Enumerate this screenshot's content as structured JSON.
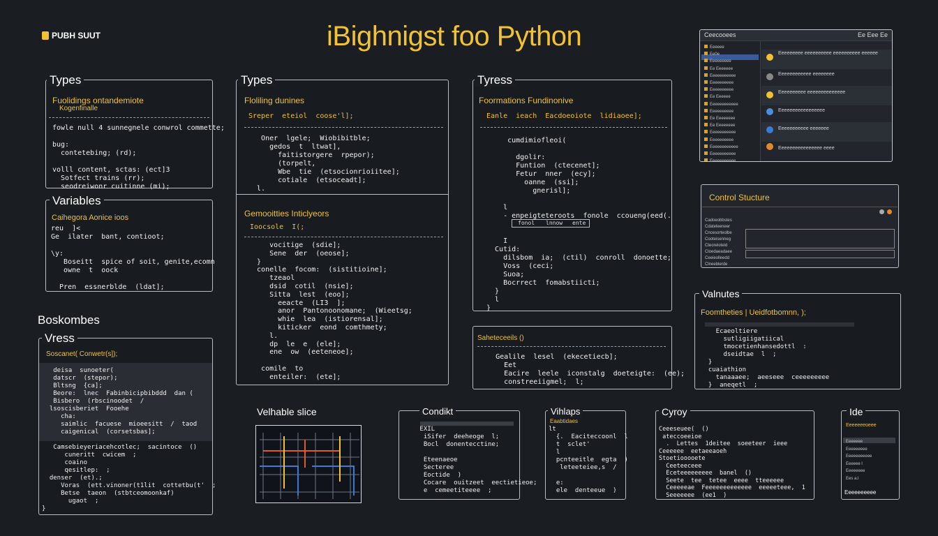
{
  "brand": "PUBH SUUT",
  "title": "iBighnigst foo Python",
  "panels": {
    "types1": {
      "header": "Types",
      "sub1": "Fuolidings ontandemiote",
      "sub2": "Kogenfinalle",
      "code": "fowle null 4 sunnegnele conwrol commette;\n\nbug:\n  contetebing; (rd);\n\nvolll content, sctas: (ect]3\n  Sotfect trains (rr);\n  seodreiwonr cuitinne (mi);"
    },
    "variables": {
      "header": "Variables",
      "sub1": "Caihegora Aonice ioos",
      "code": "reu  ]<\nGe  ilater  bant, contioot;\n\n\\y:\n   Boseitt  spice of soit, genite,ecomn\n   owne  t  oock\n\n  Pren  essnerblde  (ldat];"
    },
    "boskombes": {
      "header": "Boskombes",
      "sub_header": "Vress",
      "sub1": "Soscanet( Conwetr(s]);",
      "code": "   deisa  sunoeter(\n   datscr  (stepor);\n   Bltsng  {ca];\n   Beore:  lnec  Fabinbicipbibddd  dan (\n   Bisbero  (rbscinoodet  /\n  lsoscisberiet  Fooehe\n     cha:\n     saimlic  facuese  mioeesitt  /  taod\n     caigenical  (corsetsbas];\n\n   Camsebieyeriacehcotlec;  sacintoce  ()\n      cuneritt  cwicem  ;\n      coaino\n      qesitlep:  ;\n  denser  (et).;\n     Voras  (ett.vinoner(t1lit  cottetbu(t'  ;\n     Betse  taeon  (stbtceomoonkaf)\n       ugaot  ;\n}"
    },
    "types2": {
      "header": "Types",
      "sub1": "Floliling dunines",
      "line1": "Sreper  eteiol  coose'l];",
      "code": "   Oner  lgele;  Wiobibitble;\n     gedos  t  ltwat],\n       faitistorgere  rpepor);\n       (torpelt,\n       Wbe  tie  (etsocionrioiitee];\n       cotiale  (etsoceadt];\n  l."
    },
    "compos": {
      "sub1": "Gemooitties Inticlyeors",
      "line1": "Ioocsole  I(;",
      "code": "     vocitige  (sdie];\n     Sene  der  (oeose];\n  }\n  conelle  focom:  (sistitioine];\n     tzeaol\n     dsid  cotil  (nsie];\n     Sitta  lest  (eoo];\n       eeacte  (LI3  ];\n       anor  Pantonoonomane;  (Wieetsg;\n       whie  lea  (istiorensal];\n       kiticker  eond  comthmety;\n     l.\n     dp  le  e  (ele];\n     ene  ow  (eeteneoe];\n\n   comile  to\n     enteiler:  (ete];"
    },
    "tyress": {
      "header": "Tyress",
      "sub1": "Foormations Fundinonive",
      "line1": "Eanle  ieach  Eacdoeoiote  lidiaoee];",
      "code": "     cumdimiofleoi(\n\n       dgolir:\n       Funtion  (ctecenet];\n       Fetur  nner  (ecy];\n         oanne  (ssi];\n           gnerisl];\n\n    l\n    - enpeigteteroots  fonole  ccoueng(eed(.\n\n\n    I\n  Cutid:\n    dilsbom  ia;  (ctil)  conroll  donoette;\n    Voss  (ceci;\n    Suoa;\n    Bocrrect  fomabstiicti;\n  }\n  l\n}"
    },
    "tabs": {
      "a": "fonol",
      "b": "lnnow",
      "c": "ente"
    },
    "stelest": {
      "sub1": "Saheteceeils  ()",
      "code": "    Gealile  lesel  (ekecetiecb];\n      Eet\n      Eacire  leele  iconstalg  doeteigte:  (ee);\n      constreeiigmel;  l;"
    },
    "control": {
      "header": "Control Stucture",
      "items": [
        "Cadoeobbstes",
        "Cdateleeneer",
        "Cncesorteolbe",
        "Cooteisenneg",
        "Cteoreloteid",
        "Cloedaeadaee",
        "Ceeieolleedd",
        "Clneeblerde"
      ]
    },
    "valnutes": {
      "header": "Valnutes",
      "sub1": "Foomtheties  |  Ueidfotbomnn,  );",
      "code": "    Ecaeoltiere\n      sutligiigatiical\n      tmocetienhansedottl  :\n      dseidtae  l  ;\n  }\n  cuaiathion\n    tanaaaee;  aeeseee  ceeeeeeeee\n  }  aneqetl  ;"
    },
    "varslice": {
      "header": "Velhable slice"
    },
    "condikt": {
      "header": "Condikt",
      "code": " EXIL\n  iSifer  deeheoge  l;\n  Bocl  donentecctine;\n\n  Eteenaeoe\n  Secteree\n  Eoctide  )\n  Cocare  ouitzeet  eectietieoe;\n  e  cemeetiteeee  ;"
    },
    "vihaps": {
      "header": "Vihlaps",
      "sub1": "Eaabtidaes",
      "code": "lt\n  {.  Eaciteccoonl  l\n  t  sclet'\n  l\n  pcnteeitle  egta  )\n   leteeteiee,s  /\n\n  e:\n  ele  denteeue  )"
    },
    "cyroy": {
      "header": "Cyroy",
      "code": "Ceeeseuee(  ()\n ateccoeeioe\n  .  Lettes  1deitee  soeeteer  ieee\nCeeeeee  eetaeeaoeh\nStoetiooooete\n  Ceeteeceee\n  Eceteeeeeeeee  banel  ()\n  Seete  tee  tetee  eeee  tteeeeee\n  Ceeeeeae  Feeeeeeeeeeeee  eeeeeteee,  1\n  Seeeeeee  (ee1  )"
    },
    "ide": {
      "header": "Ide",
      "sub1": "Eeeeeeeoeee",
      "items": [
        "Eeeeeee",
        "Eeeeeeeee",
        "Eeeeeeeeeee",
        "Eeeeee  l",
        "Eeeeeeee",
        "Ees  a.l"
      ],
      "footer": "Eeeeeeeeee"
    },
    "window": {
      "title": "Ceecooees",
      "buttons": "Ee  Eee  Ee",
      "tree": [
        "Eeeeee",
        "Ee0e",
        "Eeeeeeeee",
        "Ee  Eeeeeee",
        "Eeeeeeeeeee",
        "Eeeeeeeeee",
        "Eeeeeeeeee",
        "Ee  Eeeeee",
        "Eeeeeeeeeeee",
        "Eeeeeeeeee",
        "Ee  Eeeeeeee",
        "Ee  Eeeeeeee",
        "Eeeeeeeeeee",
        "Eeeeeeeeee",
        "Eeeeeeeeeeee",
        "Eeeeeeeeeee",
        "Eeeeeeeeeee",
        "Eeeeeeeeeee",
        "Eeeeeeee",
        "Eeeeeeeeee"
      ],
      "messages": [
        "Eeeeeeeee  eeeeeeeeee  eeeeeeeeee  eeeeee",
        "Eeeeeeeeeeee  eeeeeeee",
        "Eeeeeeeeee  eeeeeeeeeeeeee",
        "Eeeeeeeeeeeeeeeee",
        "Eeeeeeeeeee  eeeeeee",
        "Eeeeeeeeeeeeeeee  eeee"
      ]
    }
  },
  "colors": {
    "accent": "#f2c230",
    "green": "#b7d94a",
    "bg": "#1a1d22",
    "border": "#b9bec6"
  }
}
